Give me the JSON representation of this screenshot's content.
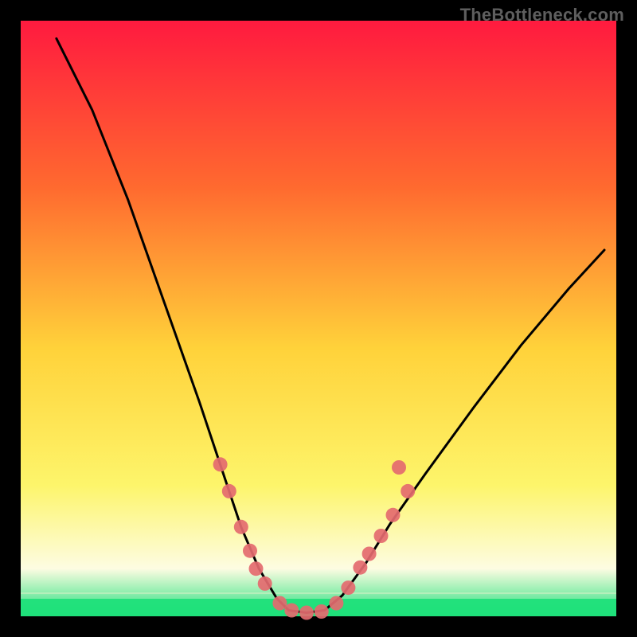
{
  "watermark": "TheBottleneck.com",
  "colors": {
    "black": "#000000",
    "gradient_top": "#ff1a3f",
    "gradient_mid_upper": "#ff6a2f",
    "gradient_mid": "#ffd23a",
    "gradient_lower": "#fdf56b",
    "gradient_pale": "#fdfce2",
    "gradient_green": "#1fe07a",
    "curve": "#000000",
    "marker_fill": "#e46a6f",
    "marker_stroke": "#c9474f"
  },
  "chart_data": {
    "type": "line",
    "title": "",
    "xlabel": "",
    "ylabel": "",
    "xlim": [
      0,
      100
    ],
    "ylim": [
      0,
      100
    ],
    "grid": false,
    "curve_points": [
      {
        "x": 6.0,
        "y": 97.0
      },
      {
        "x": 12.0,
        "y": 85.0
      },
      {
        "x": 18.0,
        "y": 70.0
      },
      {
        "x": 24.0,
        "y": 53.0
      },
      {
        "x": 30.0,
        "y": 36.0
      },
      {
        "x": 34.0,
        "y": 24.0
      },
      {
        "x": 37.0,
        "y": 15.0
      },
      {
        "x": 40.0,
        "y": 8.0
      },
      {
        "x": 43.0,
        "y": 3.0
      },
      {
        "x": 45.0,
        "y": 1.0
      },
      {
        "x": 48.0,
        "y": 0.6
      },
      {
        "x": 51.0,
        "y": 1.0
      },
      {
        "x": 54.0,
        "y": 3.5
      },
      {
        "x": 58.0,
        "y": 9.0
      },
      {
        "x": 62.0,
        "y": 15.5
      },
      {
        "x": 68.0,
        "y": 24.0
      },
      {
        "x": 76.0,
        "y": 35.0
      },
      {
        "x": 84.0,
        "y": 45.5
      },
      {
        "x": 92.0,
        "y": 55.0
      },
      {
        "x": 98.0,
        "y": 61.5
      }
    ],
    "markers": [
      {
        "x": 33.5,
        "y": 25.5
      },
      {
        "x": 35.0,
        "y": 21.0
      },
      {
        "x": 37.0,
        "y": 15.0
      },
      {
        "x": 38.5,
        "y": 11.0
      },
      {
        "x": 39.5,
        "y": 8.0
      },
      {
        "x": 41.0,
        "y": 5.5
      },
      {
        "x": 43.5,
        "y": 2.2
      },
      {
        "x": 45.5,
        "y": 1.0
      },
      {
        "x": 48.0,
        "y": 0.6
      },
      {
        "x": 50.5,
        "y": 0.8
      },
      {
        "x": 53.0,
        "y": 2.2
      },
      {
        "x": 55.0,
        "y": 4.8
      },
      {
        "x": 57.0,
        "y": 8.2
      },
      {
        "x": 58.5,
        "y": 10.5
      },
      {
        "x": 60.5,
        "y": 13.5
      },
      {
        "x": 62.5,
        "y": 17.0
      },
      {
        "x": 65.0,
        "y": 21.0
      },
      {
        "x": 63.5,
        "y": 25.0
      }
    ],
    "legend": null
  }
}
